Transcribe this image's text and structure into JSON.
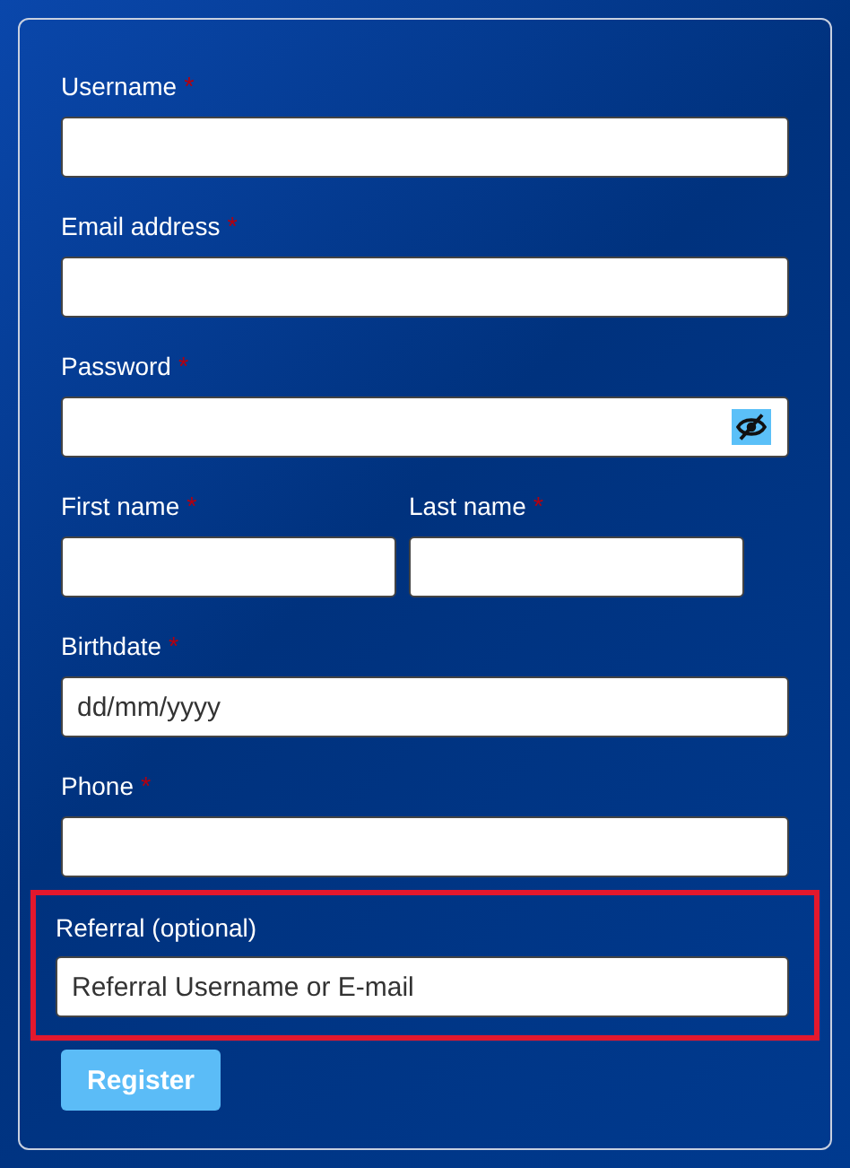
{
  "rows": [
    [
      {
        "label": "Username",
        "required_mark": "*",
        "kind": "text"
      }
    ],
    [
      {
        "label": "Email address",
        "required_mark": "*",
        "kind": "text"
      }
    ],
    [
      {
        "label": "Password",
        "required_mark": "*",
        "kind": "password",
        "reveal_on": false
      }
    ],
    [
      {
        "label": "First name",
        "required_mark": "*",
        "kind": "text"
      },
      {
        "label": "Last name",
        "required_mark": "*",
        "kind": "text"
      }
    ],
    [
      {
        "label": "Birthdate",
        "required_mark": "*",
        "kind": "text",
        "placeholder": "dd/mm/yyyy"
      }
    ],
    [
      {
        "label": "Phone",
        "required_mark": "*",
        "kind": "text"
      }
    ],
    [
      {
        "label": "Referral (optional)",
        "kind": "text",
        "placeholder": "Referral Username or E-mail",
        "highlighted": true
      }
    ]
  ],
  "submit": {
    "label": "Register"
  }
}
